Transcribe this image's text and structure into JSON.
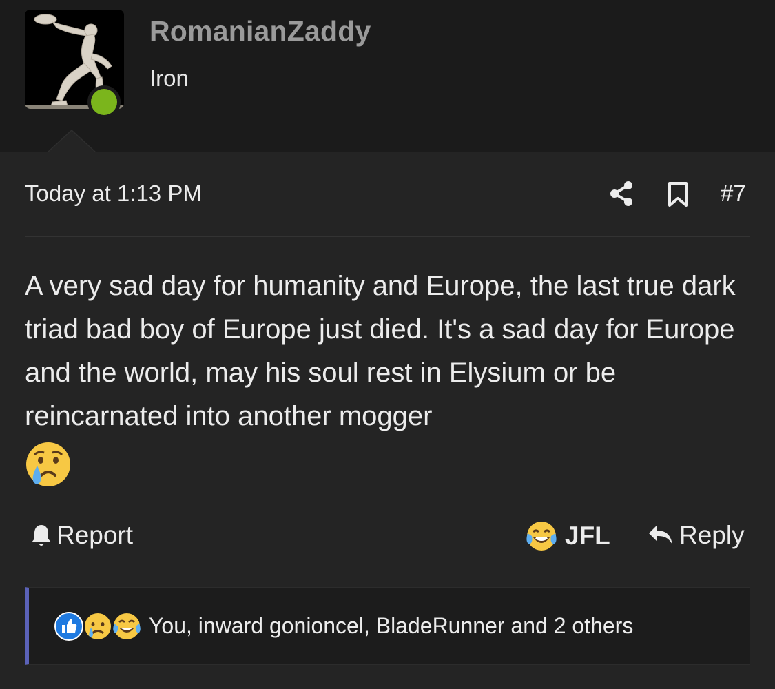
{
  "user": {
    "name": "RomanianZaddy",
    "rank": "Iron",
    "online_color": "#7bb51c"
  },
  "post": {
    "timestamp": "Today at 1:13 PM",
    "number": "#7",
    "body": "A very sad day for humanity and Europe, the last true dark triad bad boy of Europe just died. It's a sad day for Europe and the world, may his soul rest in Elysium or be reincarnated into another mogger",
    "trailing_emoji": "crying-face"
  },
  "actions": {
    "report_label": "Report",
    "jfl_label": "JFL",
    "reply_label": "Reply"
  },
  "reactions": {
    "icons": [
      "like-icon",
      "sad-icon",
      "laughing-crying-icon"
    ],
    "summary": "You, inward gonioncel, BladeRunner and 2 others",
    "accent_color": "#5b62b8"
  }
}
